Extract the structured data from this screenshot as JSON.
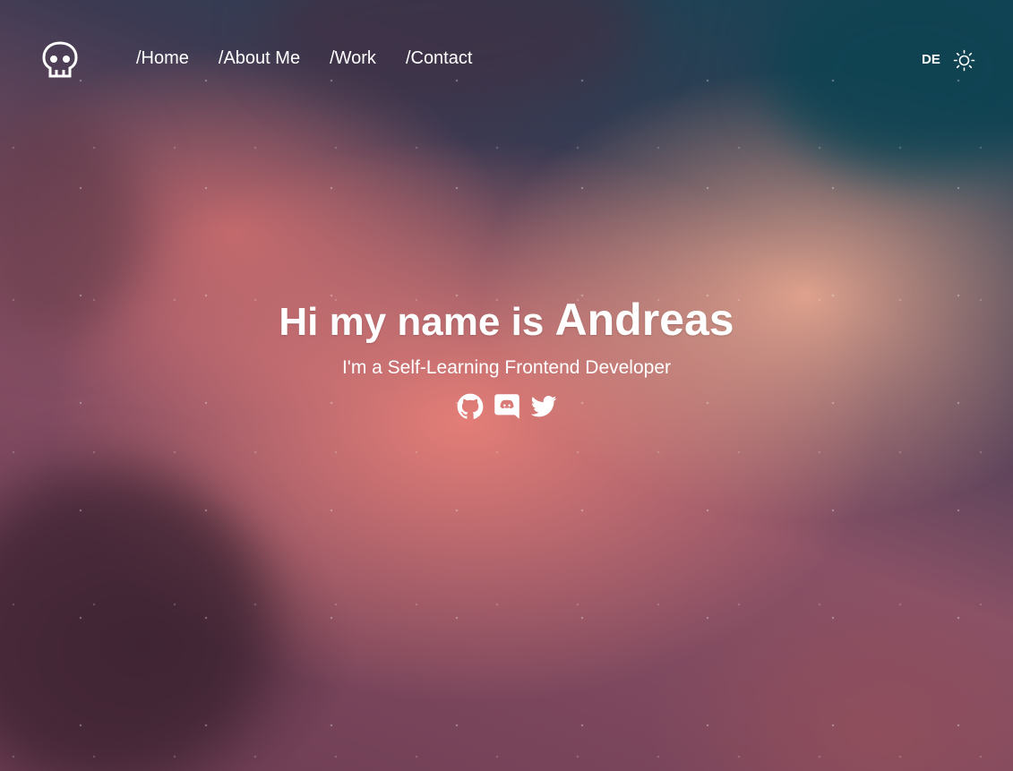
{
  "colors": {
    "text": "#ffffff",
    "sky_teal": "#124656",
    "cloud_pink": "#e88078"
  },
  "header": {
    "logo_icon": "skull-icon",
    "nav": [
      {
        "label": "/Home"
      },
      {
        "label": "/About Me"
      },
      {
        "label": "/Work"
      },
      {
        "label": "/Contact"
      }
    ],
    "language_label": "DE",
    "theme_icon": "sun-icon"
  },
  "hero": {
    "title_prefix": "Hi my name is",
    "name": "Andreas",
    "subtitle": "I'm a Self-Learning Frontend Developer",
    "socials": [
      {
        "icon": "github-icon"
      },
      {
        "icon": "discord-icon"
      },
      {
        "icon": "twitter-icon"
      }
    ]
  }
}
